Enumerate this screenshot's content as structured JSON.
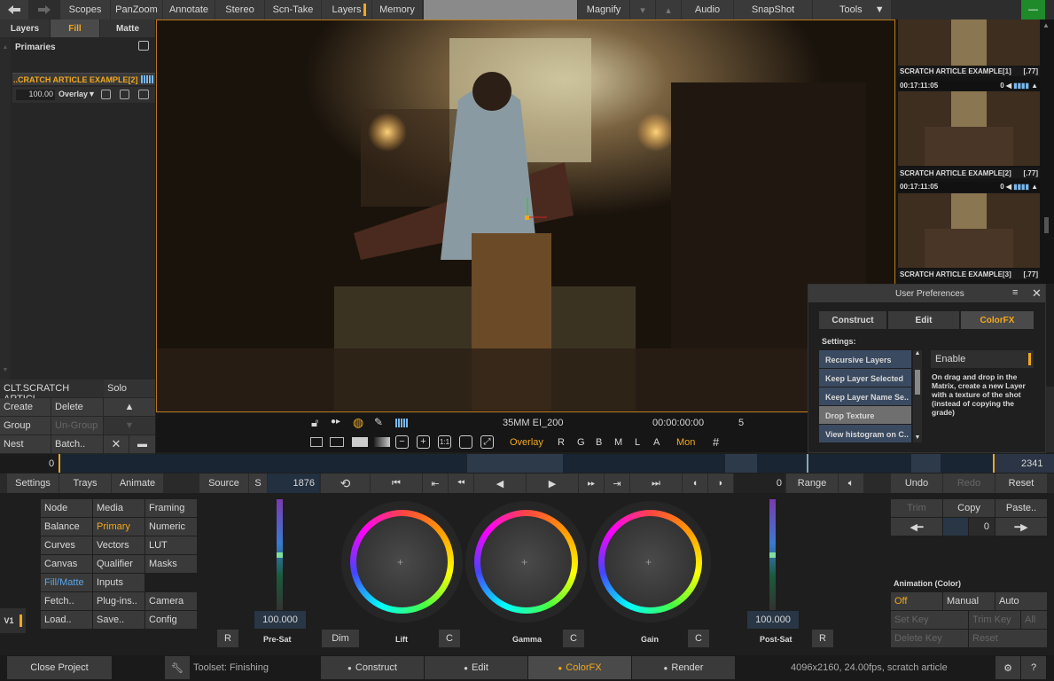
{
  "topbar": {
    "items": [
      "Scopes",
      "PanZoom",
      "Annotate",
      "Stereo",
      "Scn-Take",
      "Layers",
      "Memory"
    ],
    "right_items": [
      "Magnify",
      "Audio",
      "SnapShot",
      "Tools"
    ]
  },
  "left_panel": {
    "tabs": [
      "Layers",
      "Fill",
      "Matte"
    ],
    "section_title": "Primaries",
    "layer_name": "..CRATCH ARTICLE EXAMPLE[2]",
    "opacity_value": "100.00",
    "blend_mode": "Overlay▼",
    "clip_name": "CLT.SCRATCH ARTICL",
    "solo_label": "Solo",
    "buttons": [
      "Create",
      "Delete",
      "Group",
      "Un-Group",
      "Nest",
      "Batch.."
    ]
  },
  "viewer": {
    "clip_info": "35MM EI_200",
    "timecode": "00:00:00:00",
    "frame": "5",
    "overlay_label": "Overlay",
    "channels": [
      "R",
      "G",
      "B",
      "M",
      "L",
      "A"
    ],
    "mon_label": "Mon"
  },
  "thumbnails": [
    {
      "name": "SCRATCH ARTICLE EXAMPLE[1]",
      "aspect": "[.77]",
      "tc": "00:17:11:05",
      "vol": "0"
    },
    {
      "name": "SCRATCH ARTICLE EXAMPLE[2]",
      "aspect": "[.77]",
      "tc": "00:17:11:05",
      "vol": "0"
    },
    {
      "name": "SCRATCH ARTICLE EXAMPLE[3]",
      "aspect": "[.77]"
    }
  ],
  "prefs": {
    "title": "User Preferences",
    "tabs": [
      "Construct",
      "Edit",
      "ColorFX"
    ],
    "settings_label": "Settings:",
    "items": [
      "Recursive Layers",
      "Keep Layer Selected",
      "Keep Layer Name Se..",
      "Drop Texture",
      "View histogram on C.."
    ],
    "enable_label": "Enable",
    "description": "On drag and drop in the Matrix, create a new Layer with a texture of the shot (instead of copying the grade)"
  },
  "timeline": {
    "start": "0",
    "end": "2341"
  },
  "transport": {
    "settings": "Settings",
    "trays": "Trays",
    "animate": "Animate",
    "source": "Source",
    "s": "S",
    "source_frame": "1876",
    "range_value": "0",
    "range": "Range",
    "undo": "Undo",
    "redo": "Redo",
    "reset": "Reset"
  },
  "menu_grid": [
    [
      "Node",
      "Media",
      "Framing"
    ],
    [
      "Balance",
      "Primary",
      "Numeric"
    ],
    [
      "Curves",
      "Vectors",
      "LUT"
    ],
    [
      "Canvas",
      "Qualifier",
      "Masks"
    ],
    [
      "Fill/Matte",
      "Inputs",
      ""
    ],
    [
      "Fetch..",
      "Plug-ins..",
      "Camera"
    ],
    [
      "Load..",
      "Save..",
      "Config"
    ]
  ],
  "version_label": "V1",
  "color": {
    "presat_value": "100.000",
    "postsat_value": "100.000",
    "r_label": "R",
    "presat_label": "Pre-Sat",
    "dim_label": "Dim",
    "lift_label": "Lift",
    "c_label": "C",
    "gamma_label": "Gamma",
    "gain_label": "Gain",
    "postsat_label": "Post-Sat"
  },
  "clipboard": {
    "trim": "Trim",
    "copy": "Copy",
    "paste": "Paste..",
    "value": "0"
  },
  "animation": {
    "title": "Animation (Color)",
    "modes": [
      "Off",
      "Manual",
      "Auto"
    ],
    "actions": [
      "Set Key",
      "Trim Key",
      "All",
      "Delete Key",
      "Reset"
    ]
  },
  "statusbar": {
    "close_project": "Close Project",
    "toolset": "Toolset: Finishing",
    "tabs": [
      "Construct",
      "Edit",
      "ColorFX",
      "Render"
    ],
    "info": "4096x2160, 24.00fps, scratch article",
    "help": "?"
  },
  "colors": {
    "accent": "#f2a81d",
    "blue_text": "#5aa5e8",
    "green_button": "#1f8a2a"
  }
}
